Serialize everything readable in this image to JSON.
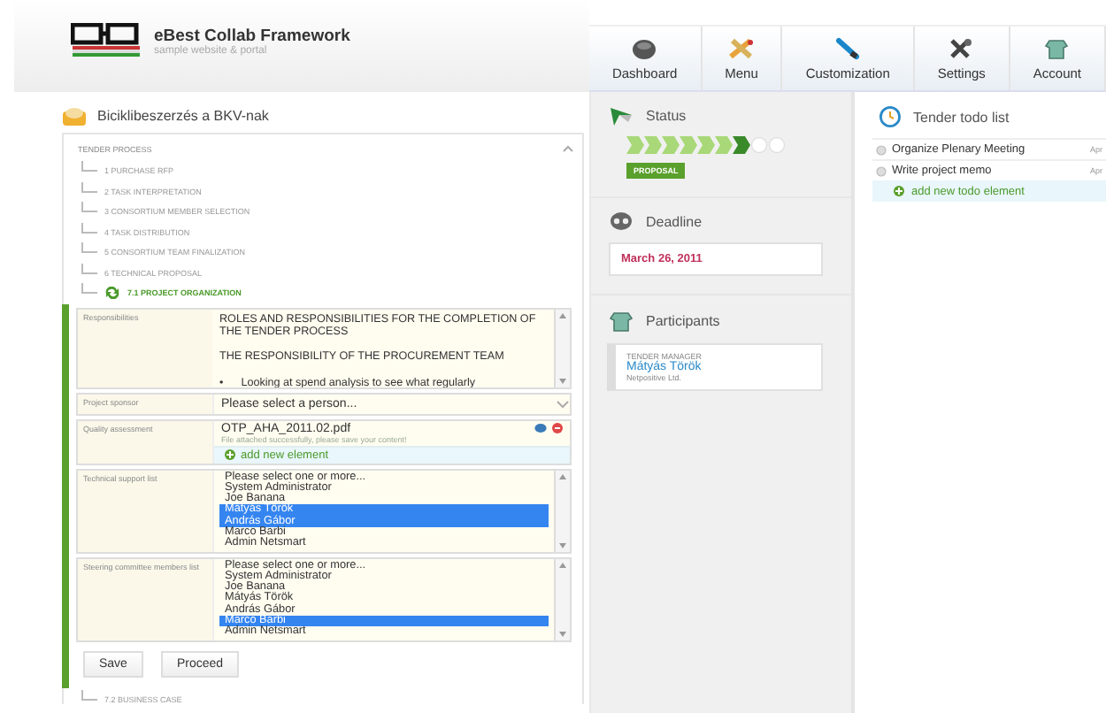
{
  "header": {
    "title": "eBest Collab Framework",
    "subtitle": "sample website & portal"
  },
  "nav": [
    {
      "label": "Dashboard"
    },
    {
      "label": "Menu"
    },
    {
      "label": "Customization"
    },
    {
      "label": "Settings"
    },
    {
      "label": "Account"
    }
  ],
  "project": {
    "title": "Biciklibeszerzés a BKV-nak",
    "tree_heading": "TENDER PROCESS",
    "steps": [
      {
        "label": "1 PURCHASE RFP",
        "current": false
      },
      {
        "label": "2 TASK INTERPRETATION",
        "current": false
      },
      {
        "label": "3 CONSORTIUM MEMBER SELECTION",
        "current": false
      },
      {
        "label": "4 TASK DISTRIBUTION",
        "current": false
      },
      {
        "label": "5 CONSORTIUM TEAM FINALIZATION",
        "current": false
      },
      {
        "label": "6 TECHNICAL PROPOSAL",
        "current": false
      },
      {
        "label": "7.1 PROJECT ORGANIZATION",
        "current": true
      }
    ],
    "form": [
      {
        "kind": "richtext",
        "label": "Responsibilities",
        "lines": [
          {
            "text": "ROLES AND RESPONSIBILITIES FOR THE COMPLETION OF THE TENDER PROCESS"
          },
          {
            "text": "THE RESPONSIBILITY OF THE PROCUREMENT TEAM"
          },
          {
            "bullet": "•",
            "text": "Looking at spend analysis to see what regularly"
          }
        ]
      },
      {
        "kind": "select",
        "label": "Project sponsor",
        "placeholder": "Please select a person..."
      },
      {
        "kind": "file",
        "label": "Quality assessment",
        "file": "OTP_AHA_2011.02.pdf",
        "note": "File attached successfully, please save your content!",
        "add": "add new element"
      },
      {
        "kind": "multiselect",
        "label": "Technical support list",
        "options": [
          {
            "text": "Please select one or more...",
            "selected": false
          },
          {
            "text": "System Administrator",
            "selected": false
          },
          {
            "text": "Joe Banana",
            "selected": false
          },
          {
            "text": "Mátyás Török",
            "selected": true
          },
          {
            "text": "András Gábor",
            "selected": true
          },
          {
            "text": "Marco Barbi",
            "selected": false
          },
          {
            "text": "Admin Netsmart",
            "selected": false
          }
        ]
      },
      {
        "kind": "multiselect",
        "label": "Steering committee members list",
        "options": [
          {
            "text": "Please select one or more...",
            "selected": false
          },
          {
            "text": "System Administrator",
            "selected": false
          },
          {
            "text": "Joe Banana",
            "selected": false
          },
          {
            "text": "Mátyás Török",
            "selected": false
          },
          {
            "text": "András Gábor",
            "selected": false
          },
          {
            "text": "Marco Barbi",
            "selected": true
          },
          {
            "text": "Admin Netsmart",
            "selected": false
          }
        ]
      }
    ],
    "buttons": [
      "Save",
      "Proceed"
    ],
    "next_step": "7.2 BUSINESS CASE"
  },
  "status": {
    "heading": "Status",
    "badge": "PROPOSAL"
  },
  "deadline": {
    "heading": "Deadline",
    "date": "March 26, 2011"
  },
  "participants": {
    "heading": "Participants",
    "role": "TENDER MANAGER",
    "name": "Mátyás Török",
    "company": "Netpositive Ltd."
  },
  "todo": {
    "heading": "Tender todo list",
    "items": [
      {
        "text": "Organize Plenary Meeting",
        "date": "Apr"
      },
      {
        "text": "Write project memo",
        "date": "Apr"
      }
    ],
    "add": "add new todo element"
  }
}
